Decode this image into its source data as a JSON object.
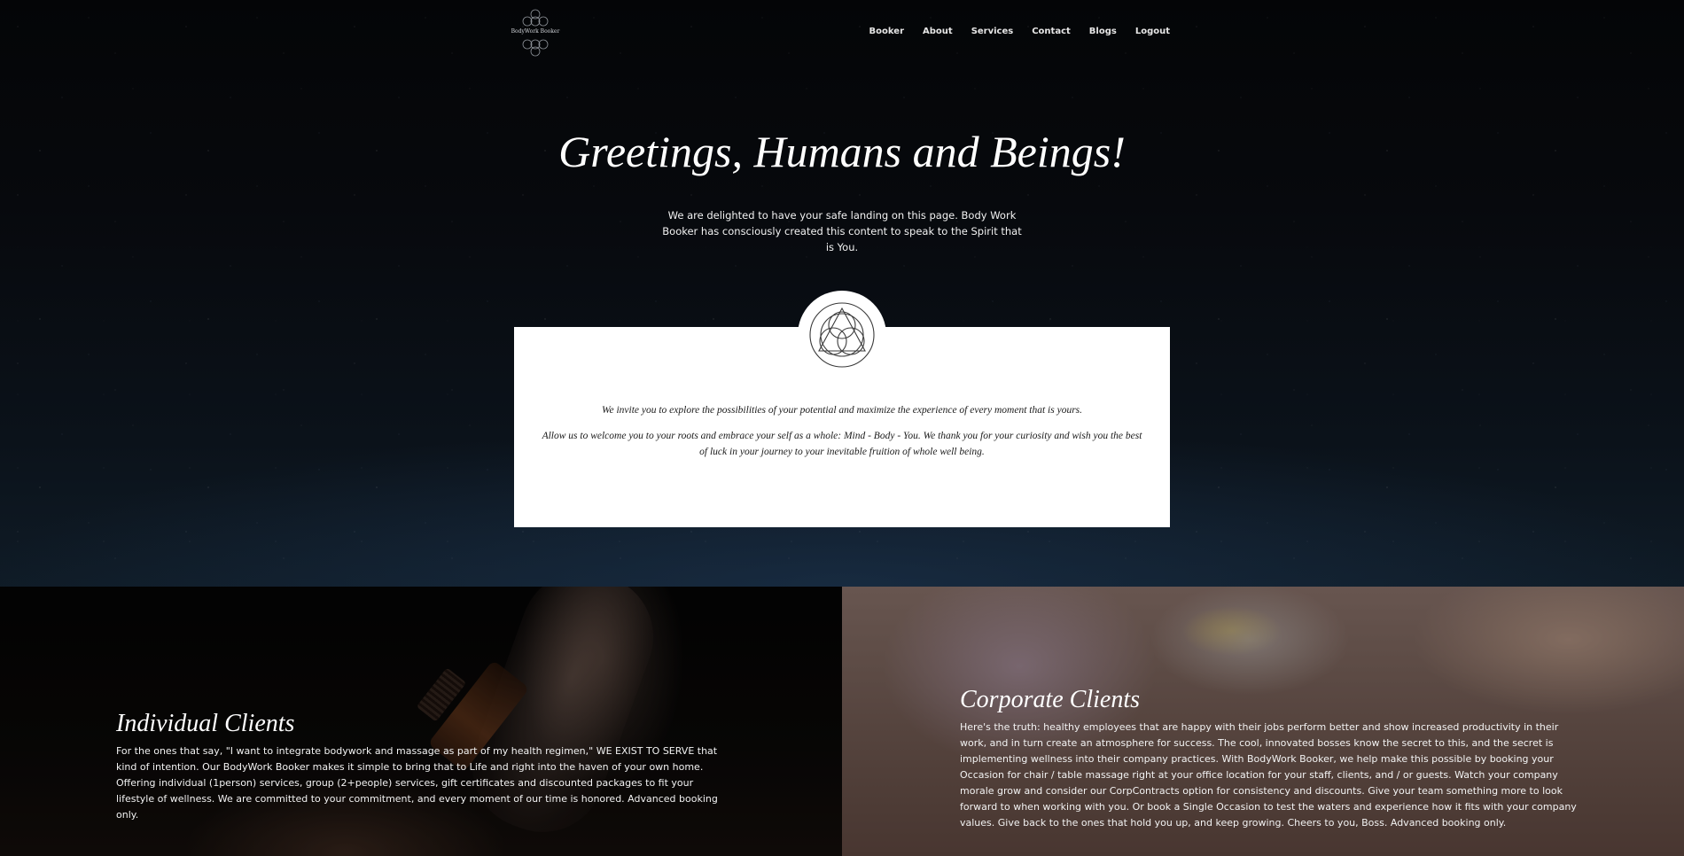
{
  "nav": {
    "logo_text": "BodyWork Booker",
    "items": [
      {
        "label": "Booker"
      },
      {
        "label": "About"
      },
      {
        "label": "Services"
      },
      {
        "label": "Contact"
      },
      {
        "label": "Blogs"
      },
      {
        "label": "Logout"
      }
    ]
  },
  "hero": {
    "title": "Greetings, Humans and Beings!",
    "subtitle": "We are delighted to have your safe landing on this page. Body Work Booker has consciously created this content to speak to the Spirit that is You."
  },
  "card": {
    "paragraph_1": "We invite you to explore the possibilities of your potential and maximize the experience of every moment that is yours.",
    "paragraph_2": "Allow us to welcome you to your roots and embrace your self as a whole: Mind - Body - You. We thank you for your curiosity and wish you the best of luck in your journey to your inevitable fruition of whole well being."
  },
  "individual": {
    "title": "Individual Clients",
    "body": "For the ones that say, \"I want to integrate bodywork and massage as part of my health regimen,\" WE EXIST TO SERVE that kind of intention. Our BodyWork Booker makes it simple to bring that to Life and right into the haven of your own home. Offering individual (1person) services, group (2+people) services, gift certificates and discounted packages to fit your lifestyle of wellness. We are committed to your commitment, and every moment of our time is honored. Advanced booking only."
  },
  "corporate": {
    "title": "Corporate Clients",
    "body": "Here's the truth: healthy employees that are happy with their jobs perform better and show increased productivity in their work, and in turn create an atmosphere for success. The cool, innovated bosses know the secret to this, and the secret is implementing wellness into their company practices. With BodyWork Booker, we help make this possible by booking your Occasion for chair / table massage right at your office location for your staff, clients, and / or guests. Watch your company morale grow and consider our CorpContracts option for consistency and discounts. Give your team something more to look forward to when working with you. Or book a Single Occasion to test the waters and experience how it fits with your company values. Give back to the ones that hold you up, and keep growing. Cheers to you, Boss. Advanced booking only."
  },
  "icons": {
    "logo": "flower-of-life-logo-icon",
    "emblem": "triquetra-circles-emblem-icon"
  },
  "colors": {
    "background": "#06080c",
    "card": "#ffffff",
    "text": "#ffffff"
  }
}
